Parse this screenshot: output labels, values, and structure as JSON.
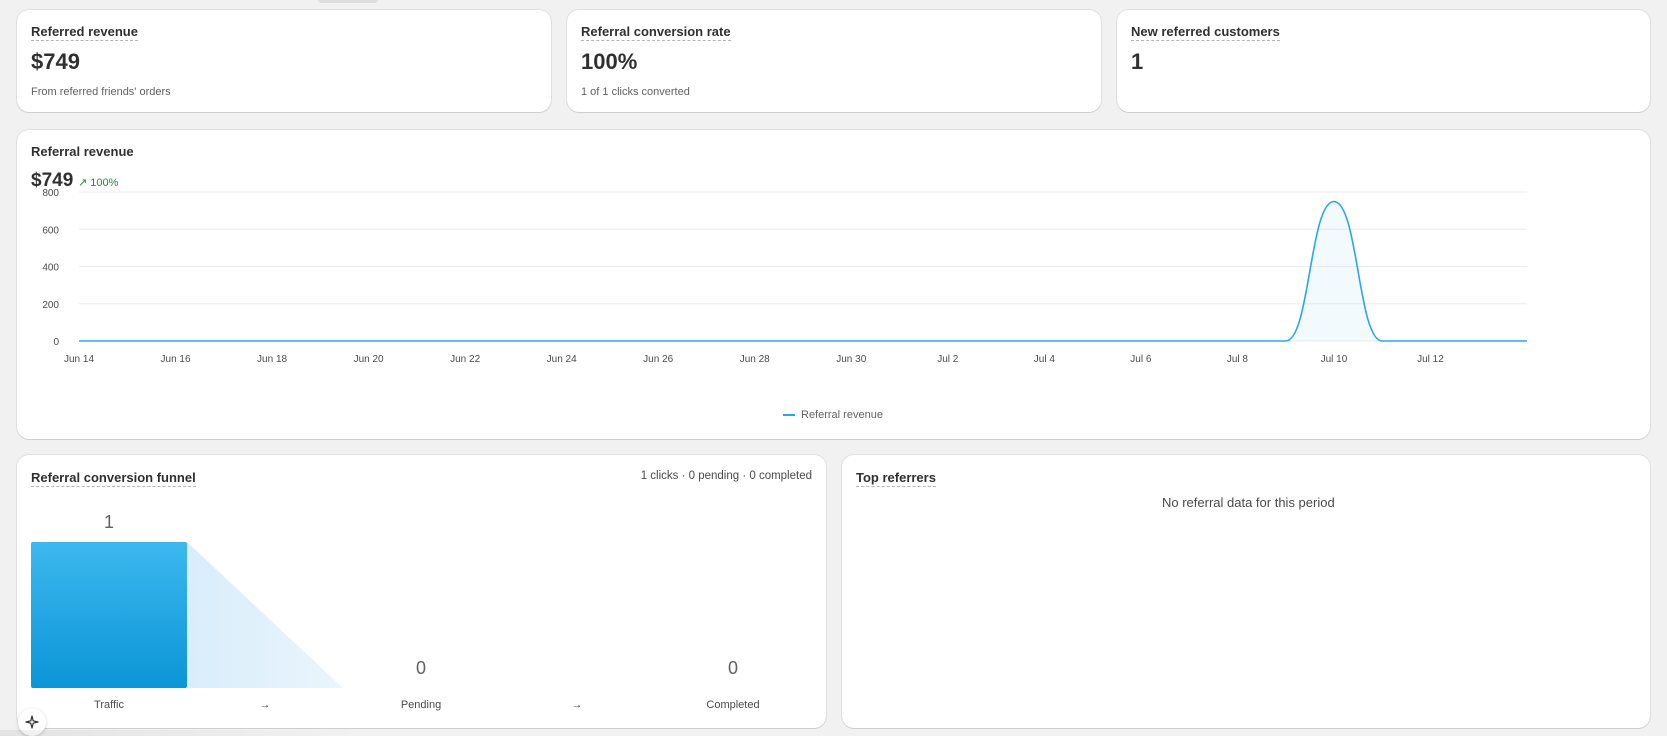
{
  "metrics": [
    {
      "title": "Referred revenue",
      "value": "$749",
      "sub": "From referred friends' orders"
    },
    {
      "title": "Referral conversion rate",
      "value": "100%",
      "sub": "1 of 1 clicks converted"
    },
    {
      "title": "New referred customers",
      "value": "1",
      "sub": ""
    }
  ],
  "revenue_chart": {
    "title": "Referral revenue",
    "total": "$749",
    "trend": "100%",
    "legend": "Referral revenue"
  },
  "chart_data": {
    "type": "area",
    "title": "Referral revenue",
    "xlabel": "",
    "ylabel": "",
    "x": [
      "Jun 14",
      "Jun 15",
      "Jun 16",
      "Jun 17",
      "Jun 18",
      "Jun 19",
      "Jun 20",
      "Jun 21",
      "Jun 22",
      "Jun 23",
      "Jun 24",
      "Jun 25",
      "Jun 26",
      "Jun 27",
      "Jun 28",
      "Jun 29",
      "Jun 30",
      "Jul 1",
      "Jul 2",
      "Jul 3",
      "Jul 4",
      "Jul 5",
      "Jul 6",
      "Jul 7",
      "Jul 8",
      "Jul 9",
      "Jul 10",
      "Jul 11",
      "Jul 12",
      "Jul 13",
      "Jul 14"
    ],
    "series": [
      {
        "name": "Referral revenue",
        "values": [
          0,
          0,
          0,
          0,
          0,
          0,
          0,
          0,
          0,
          0,
          0,
          0,
          0,
          0,
          0,
          0,
          0,
          0,
          0,
          0,
          0,
          0,
          0,
          0,
          0,
          0,
          749,
          0,
          0,
          0,
          0
        ]
      }
    ],
    "x_tick_labels": [
      "Jun 14",
      "Jun 16",
      "Jun 18",
      "Jun 20",
      "Jun 22",
      "Jun 24",
      "Jun 26",
      "Jun 28",
      "Jun 30",
      "Jul 2",
      "Jul 4",
      "Jul 6",
      "Jul 8",
      "Jul 10",
      "Jul 12"
    ],
    "y_ticks": [
      0,
      200,
      400,
      600,
      800
    ],
    "ylim": [
      0,
      800
    ],
    "grid": true,
    "legend_position": "bottom-center",
    "color": "#2aa6e8"
  },
  "funnel": {
    "title": "Referral conversion funnel",
    "summary": "1 clicks · 0 pending · 0 completed",
    "steps": [
      {
        "label": "Traffic",
        "value": "1",
        "count": 1
      },
      {
        "label": "Pending",
        "value": "0",
        "count": 0
      },
      {
        "label": "Completed",
        "value": "0",
        "count": 0
      }
    ],
    "arrow": "→",
    "bar_color": "#1ea3e0"
  },
  "top_referrers": {
    "title": "Top referrers",
    "empty_message": "No referral data for this period"
  },
  "icons": {
    "assistant": "sparkle-icon",
    "trend": "arrow-up-right-icon"
  }
}
